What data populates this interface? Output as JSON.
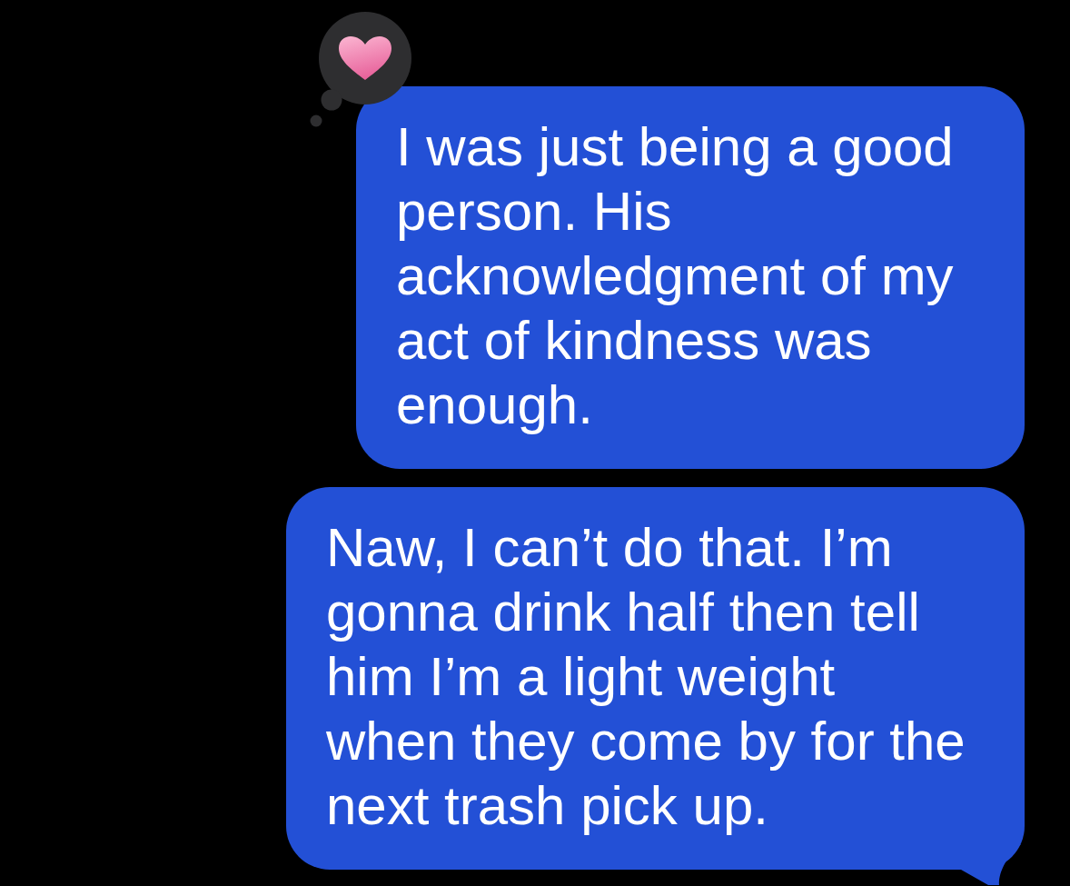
{
  "messages": [
    {
      "text": "I was just being a good person. His acknowledgment of my act of kindness was enough.",
      "reaction": {
        "kind": "heart"
      },
      "tail": false
    },
    {
      "text": "Naw, I can’t do that. I’m gonna drink half then tell him I’m a light weight when they come by for the next trash pick up.",
      "tail": true
    }
  ]
}
